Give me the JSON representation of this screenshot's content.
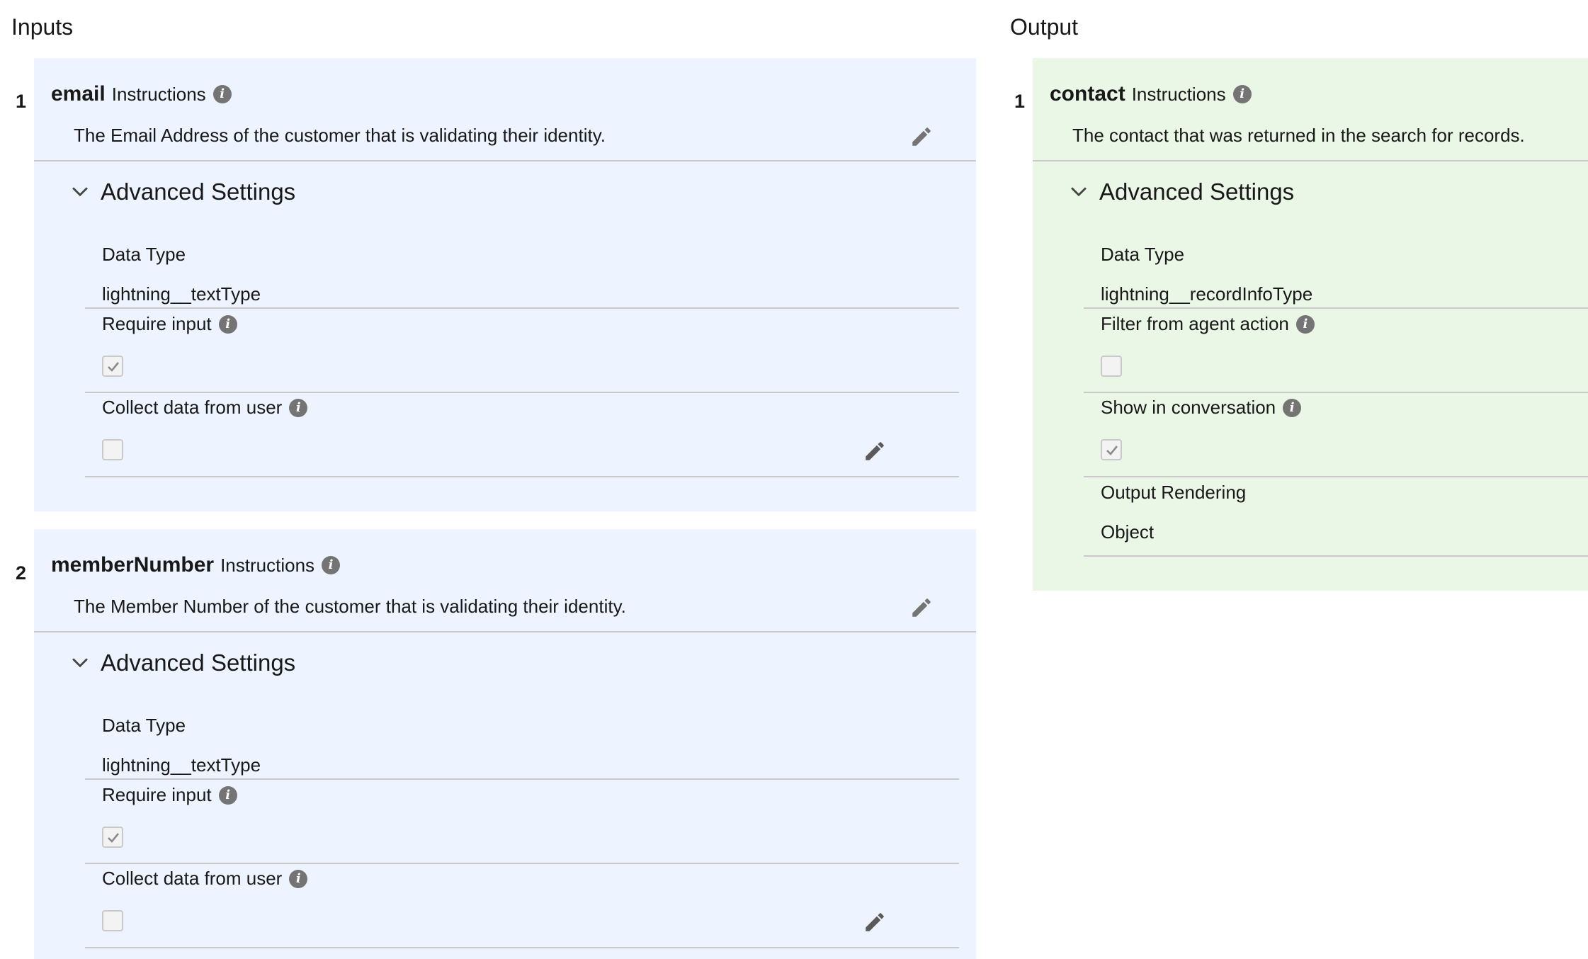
{
  "inputs": {
    "title": "Inputs",
    "items": [
      {
        "number": "1",
        "name": "email",
        "instructions_label": "Instructions",
        "description": "The Email Address of the customer that is validating their identity.",
        "advanced_label": "Advanced Settings",
        "data_type_label": "Data Type",
        "data_type_value": "lightning__textType",
        "require_input_label": "Require input",
        "require_input_checked": true,
        "collect_label": "Collect data from user",
        "collect_checked": false
      },
      {
        "number": "2",
        "name": "memberNumber",
        "instructions_label": "Instructions",
        "description": "The Member Number of the customer that is validating their identity.",
        "advanced_label": "Advanced Settings",
        "data_type_label": "Data Type",
        "data_type_value": "lightning__textType",
        "require_input_label": "Require input",
        "require_input_checked": true,
        "collect_label": "Collect data from user",
        "collect_checked": false
      }
    ]
  },
  "output": {
    "title": "Output",
    "item": {
      "number": "1",
      "name": "contact",
      "instructions_label": "Instructions",
      "description": "The contact that was returned in the search for records.",
      "advanced_label": "Advanced Settings",
      "data_type_label": "Data Type",
      "data_type_value": "lightning__recordInfoType",
      "filter_label": "Filter from agent action",
      "filter_checked": false,
      "show_label": "Show in conversation",
      "show_checked": true,
      "rendering_label": "Output Rendering",
      "rendering_value": "Object"
    }
  },
  "colors": {
    "input_panel_bg": "#eef4ff",
    "output_panel_bg": "#ebf7e6",
    "info_icon": "#747474",
    "divider": "#c9c9c9"
  },
  "icons": [
    "info-icon",
    "pencil-icon",
    "chevron-down-icon",
    "checkmark-icon"
  ]
}
